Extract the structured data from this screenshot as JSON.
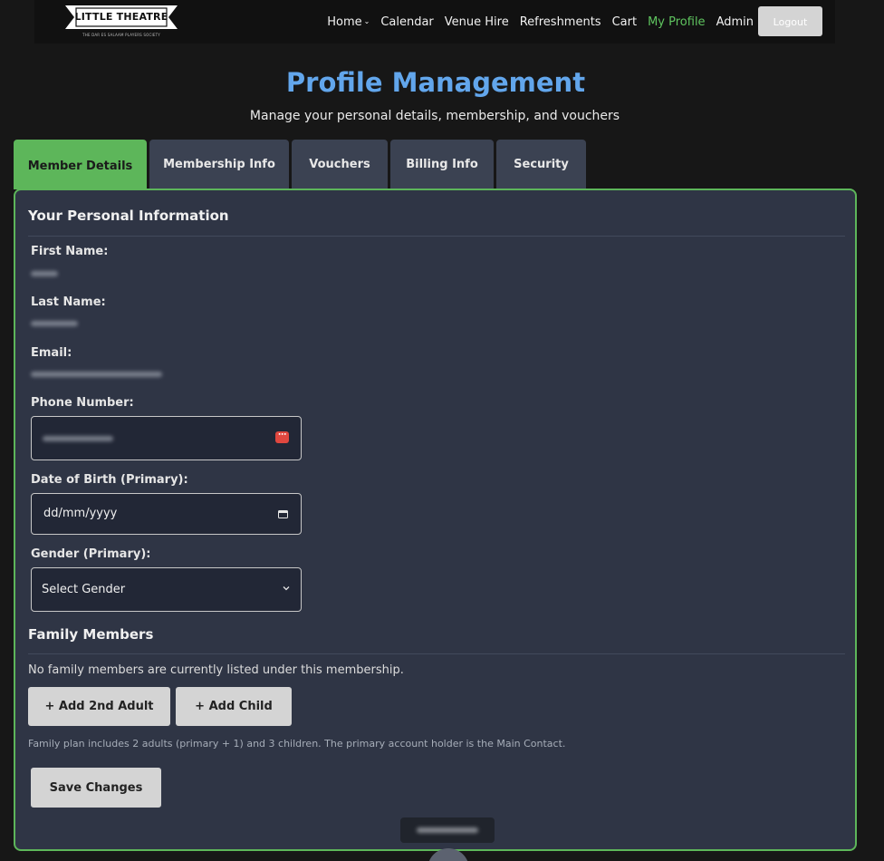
{
  "nav": {
    "logo_text": "LITTLE THEATRE",
    "logo_subtext": "THE DAR ES SALAAM PLAYERS SOCIETY",
    "items": [
      "Home",
      "Calendar",
      "Venue Hire",
      "Refreshments",
      "Cart",
      "My Profile",
      "Admin"
    ],
    "active_item": "My Profile",
    "logout_label": "Logout"
  },
  "header": {
    "title": "Profile Management",
    "subtitle": "Manage your personal details, membership, and vouchers"
  },
  "tabs": [
    "Member Details",
    "Membership Info",
    "Vouchers",
    "Billing Info",
    "Security"
  ],
  "active_tab": "Member Details",
  "personal": {
    "section_title": "Your Personal Information",
    "first_name_label": "First Name:",
    "last_name_label": "Last Name:",
    "email_label": "Email:",
    "phone_label": "Phone Number:",
    "dob_label": "Date of Birth (Primary):",
    "dob_placeholder": "dd/mm/yyyy",
    "gender_label": "Gender (Primary):",
    "gender_value": "Select Gender"
  },
  "family": {
    "section_title": "Family Members",
    "empty_message": "No family members are currently listed under this membership.",
    "add_adult_label": "+ Add 2nd Adult",
    "add_child_label": "+ Add Child",
    "note": "Family plan includes 2 adults (primary + 1) and 3 children. The primary account holder is the Main Contact."
  },
  "save_label": "Save Changes",
  "colors": {
    "accent_green": "#5db65a",
    "title_blue": "#62a6ec",
    "panel_bg": "#2f3545",
    "tab_bg": "#3b4252"
  }
}
